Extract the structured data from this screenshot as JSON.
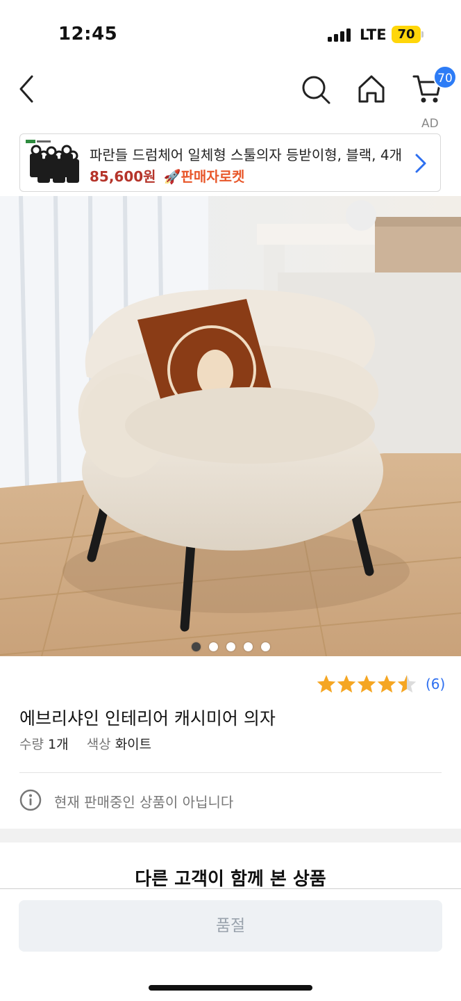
{
  "status_bar": {
    "time": "12:45",
    "network": "LTE",
    "battery": "70"
  },
  "nav": {
    "back_icon": "chevron-left-icon",
    "search_icon": "search-icon",
    "home_icon": "home-icon",
    "cart_icon": "cart-icon",
    "cart_badge": "70"
  },
  "ad": {
    "label": "AD",
    "title": "파란들 드럼체어 일체형 스툴의자 등받이형, 블랙, 4개",
    "price": "85,600원",
    "rocket_label": "🚀판매자로켓"
  },
  "gallery": {
    "total": 5,
    "current": 1
  },
  "product": {
    "rating_value": 4.5,
    "rating_count": "(6)",
    "title": "에브리샤인 인테리어 캐시미어 의자",
    "quantity_label": "수량",
    "quantity_value": "1개",
    "color_label": "색상",
    "color_value": "화이트",
    "notice": "현재 판매중인 상품이 아닙니다"
  },
  "related": {
    "title": "다른 고객이 함께 본 상품"
  },
  "bottom": {
    "button_label": "품절"
  },
  "colors": {
    "accent_blue": "#2d7cf6",
    "price_red": "#b5342a",
    "star": "#f5a623"
  }
}
